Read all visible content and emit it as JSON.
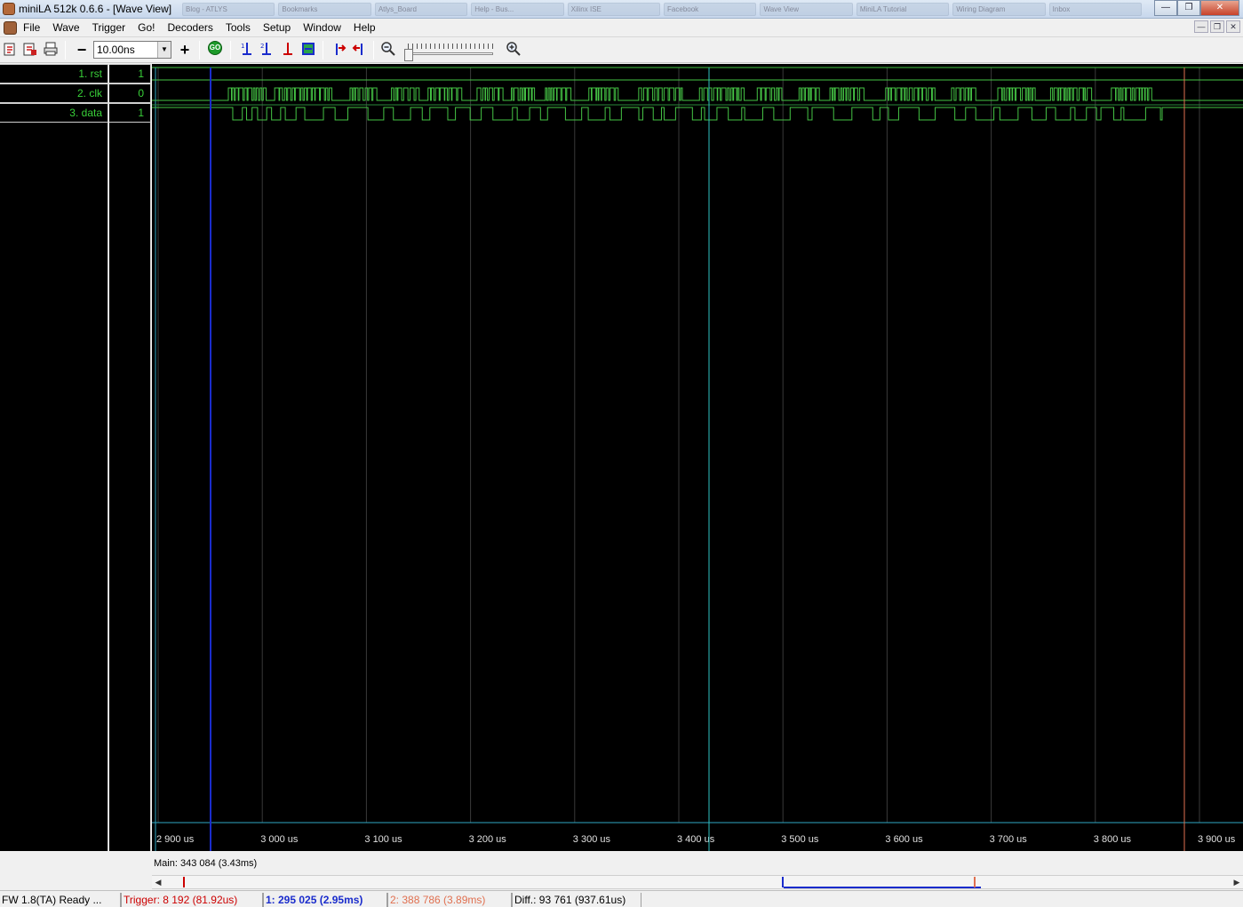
{
  "window": {
    "title": "miniLA 512k 0.6.6 - [Wave View]",
    "taskbar_items": [
      "Blog - ATLYS",
      "Bookmarks",
      "Atlys_Board",
      "Help - Bus...",
      "Xilinx ISE",
      "Facebook",
      "Wave View",
      "MiniLA Tutorial",
      "Wiring Diagram",
      "Inbox"
    ]
  },
  "menubar": {
    "items": [
      "File",
      "Wave",
      "Trigger",
      "Go!",
      "Decoders",
      "Tools",
      "Setup",
      "Window",
      "Help"
    ]
  },
  "toolbar": {
    "zoom_value": "10.00ns",
    "minus_label": "−",
    "plus_label": "+",
    "go_label": "GO"
  },
  "signals": [
    {
      "name": "1. rst",
      "value": "1"
    },
    {
      "name": "2. clk",
      "value": "0"
    },
    {
      "name": "3. data",
      "value": "1"
    }
  ],
  "time_axis": {
    "ticks": [
      "2 900 us",
      "3 000 us",
      "3 100 us",
      "3 200 us",
      "3 300 us",
      "3 400 us",
      "3 500 us",
      "3 600 us",
      "3 700 us",
      "3 800 us",
      "3 900 us"
    ]
  },
  "colors": {
    "waveform": "#45c445",
    "cursor1": "#1a2ccc",
    "cursor_main": "#2fc4c4",
    "cursor2": "#e07050",
    "trigger": "#cc0000",
    "grid": "#3a3a3a"
  },
  "cursors": {
    "main_label": "Main: 343 084  (3.43ms)"
  },
  "statusbar": {
    "firmware": "FW 1.8(TA) Ready ...",
    "trigger": "Trigger: 8 192  (81.92us)",
    "cursor1": "1: 295 025  (2.95ms)",
    "cursor2": "2: 388 786  (3.89ms)",
    "diff": "Diff.: 93 761  (937.61us)"
  }
}
